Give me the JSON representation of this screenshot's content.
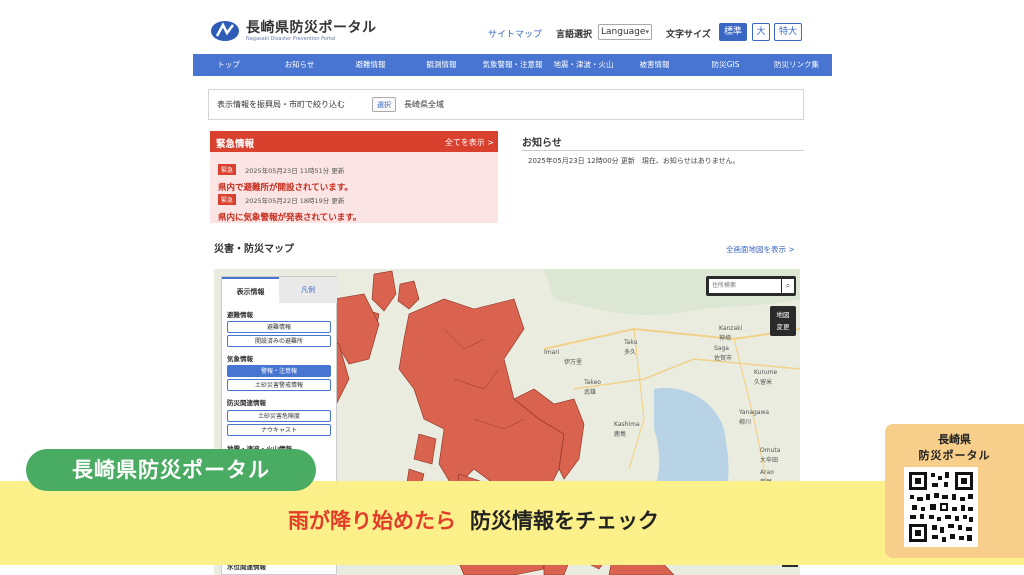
{
  "header": {
    "logo_title": "長崎県防災ポータル",
    "logo_subtitle": "Nagasaki Disaster Prevention Portal",
    "sitemap": "サイトマップ",
    "language_label": "言語選択",
    "language_select": "Language",
    "font_size_label": "文字サイズ",
    "font_sizes": [
      "標準",
      "大",
      "特大"
    ]
  },
  "nav": [
    "トップ",
    "お知らせ",
    "避難情報",
    "観測情報",
    "気象警報・注意報",
    "地震・津波・火山",
    "被害情報",
    "防災GIS",
    "防災リンク集"
  ],
  "filter": {
    "label": "表示情報を振興局・市町で絞り込む",
    "button": "選択",
    "value": "長崎県全域"
  },
  "emergency": {
    "title": "緊急情報",
    "view_all": "全てを表示 >",
    "items": [
      {
        "badge": "緊急",
        "time": "2025年05月23日 11時51分 更新",
        "text": "県内で避難所が開設されています。"
      },
      {
        "badge": "緊急",
        "time": "2025年05月22日 18時19分 更新",
        "text": "県内に気象警報が発表されています。"
      }
    ]
  },
  "notice": {
    "title": "お知らせ",
    "text": "2025年05月23日 12時00分 更新　現在、お知らせはありません。"
  },
  "map_section": {
    "title": "災害・防災マップ",
    "full_screen": "全画面地図を表示 >",
    "tabs": [
      "表示情報",
      "凡例"
    ],
    "sections": [
      {
        "title": "避難情報",
        "buttons": [
          {
            "label": "避難情報",
            "on": false
          },
          {
            "label": "開設済みの避難所",
            "on": false
          }
        ]
      },
      {
        "title": "気象情報",
        "buttons": [
          {
            "label": "警報・注意報",
            "on": true
          },
          {
            "label": "土砂災害警戒情報",
            "on": false
          }
        ]
      },
      {
        "title": "防災関連情報",
        "buttons": [
          {
            "label": "土砂災害危険度",
            "on": false
          },
          {
            "label": "ナウキャスト",
            "on": false
          }
        ]
      },
      {
        "title": "地震・津波・火山情報",
        "buttons": []
      },
      {
        "title": "水位関連情報",
        "buttons": []
      }
    ],
    "search_placeholder": "住所検索",
    "map_change": [
      "地図",
      "変更"
    ],
    "place_labels": [
      "Imari",
      "伊万里",
      "Taku",
      "多久",
      "Saga",
      "佐賀市",
      "Kanzaki",
      "神埼",
      "Takeo",
      "武雄",
      "Kashima",
      "鹿島",
      "Omuta",
      "大牟田",
      "Kurume",
      "久留米",
      "Arao",
      "荒尾",
      "Yanagawa",
      "柳川"
    ],
    "zoom_plus": "+"
  },
  "overlay": {
    "tag": "長崎県防災ポータル",
    "slogan_red": "雨が降り始めたら",
    "slogan_dark": "防災情報をチェック",
    "qr_title_1": "長崎県",
    "qr_title_2": "防災ポータル"
  },
  "colors": {
    "nav_blue": "#4875d1",
    "emergency_red": "#d9402e",
    "warning_area": "#d9634f",
    "banner_yellow": "#fbf08a",
    "tag_green": "#4aab62",
    "qr_card": "#f7ce8a"
  }
}
